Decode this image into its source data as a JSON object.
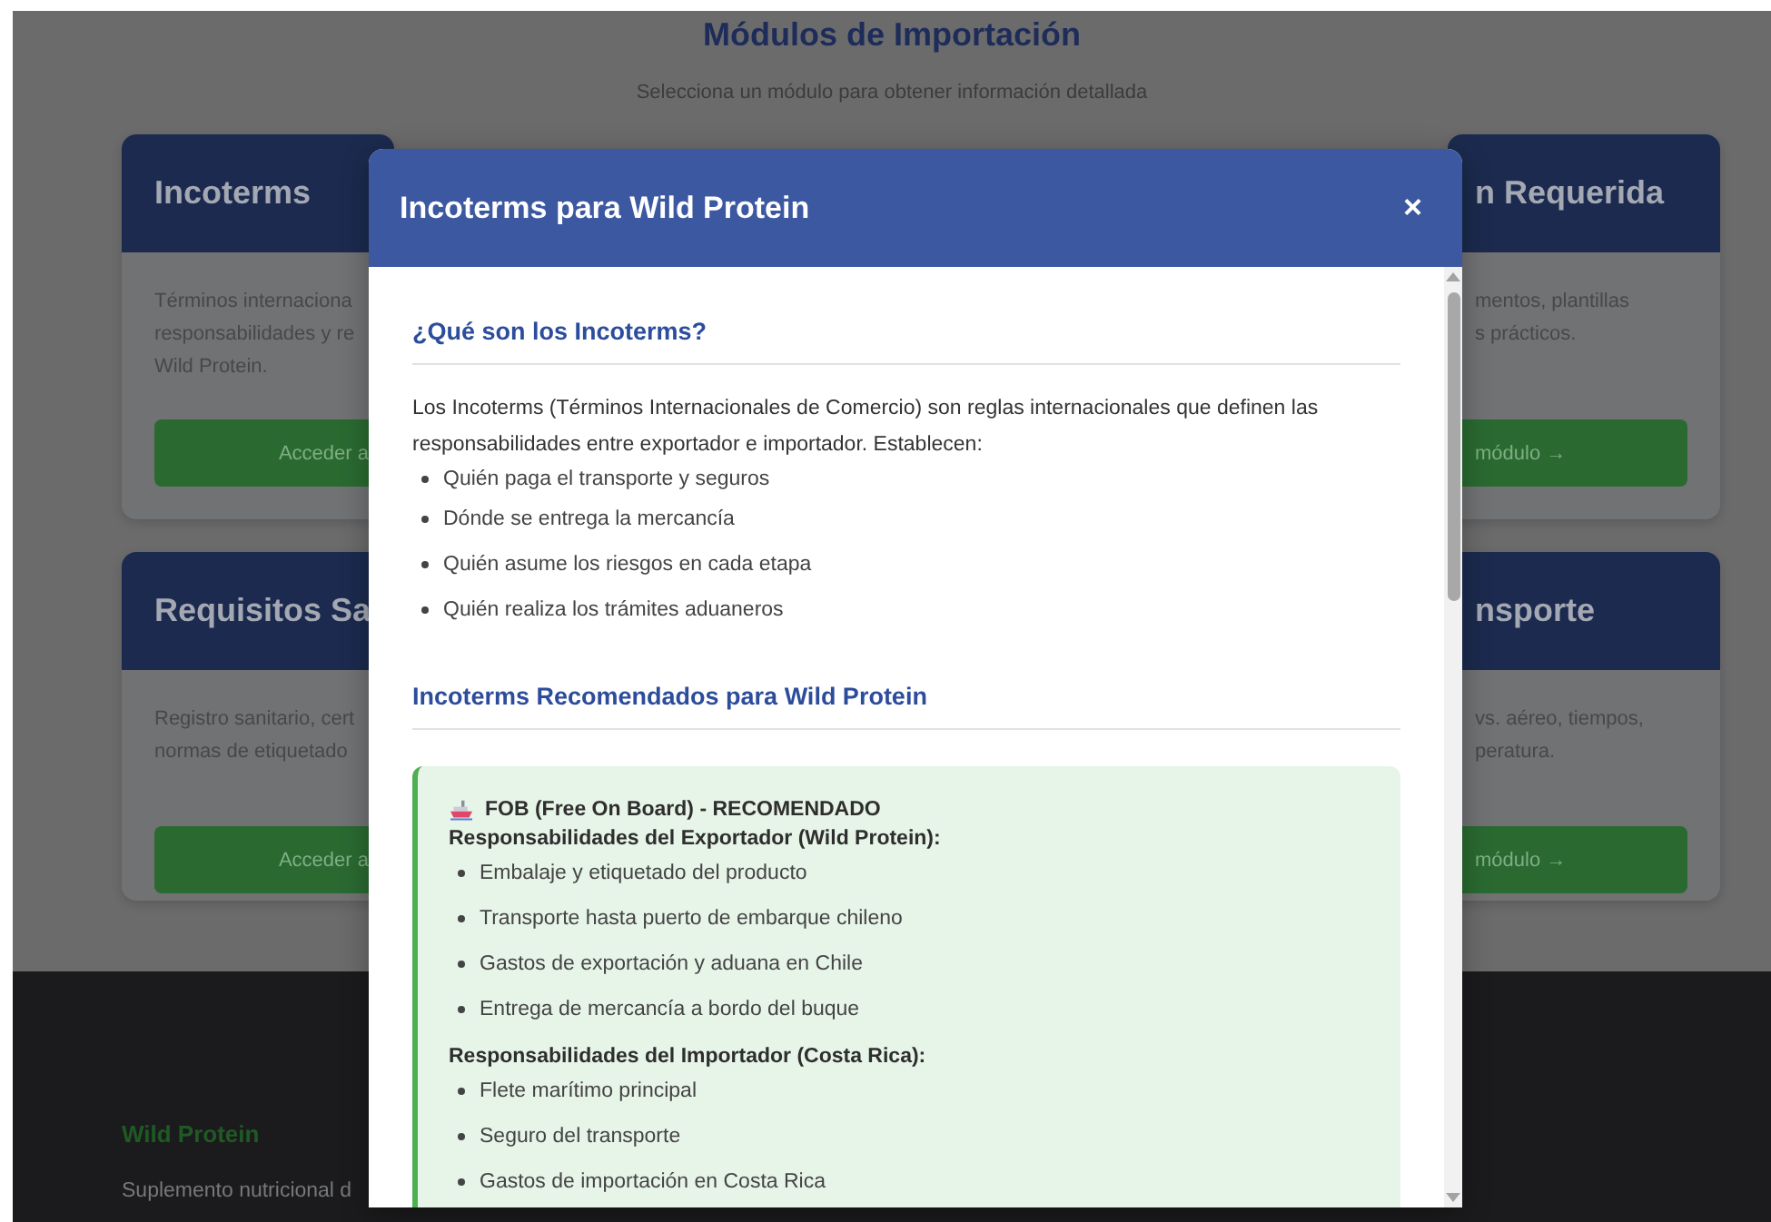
{
  "page": {
    "title": "Módulos de Importación",
    "subtitle": "Selecciona un módulo para obtener información detallada"
  },
  "cards": [
    {
      "kind": "left",
      "title": "Incoterms",
      "lines": [
        "Términos internaciona",
        "responsabilidades y re",
        "Wild Protein."
      ],
      "button": "Acceder a"
    },
    {
      "kind": "right",
      "title": "n Requerida",
      "lines": [
        "mentos, plantillas",
        "s prácticos."
      ],
      "button": "módulo →"
    },
    {
      "kind": "left",
      "title": "Requisitos Sa",
      "lines": [
        "Registro sanitario, cert",
        "normas de etiquetado"
      ],
      "button": "Acceder a"
    },
    {
      "kind": "right",
      "title": "nsporte",
      "lines": [
        "vs. aéreo, tiempos,",
        "peratura."
      ],
      "button": "módulo →"
    }
  ],
  "modal": {
    "title": "Incoterms para Wild Protein",
    "close": "×",
    "blocks": [
      {
        "kind": "heading",
        "text": "¿Qué son los Incoterms?"
      },
      {
        "kind": "paragraph",
        "text": "Los Incoterms (Términos Internacionales de Comercio) son reglas internacionales que definen las responsabilidades entre exportador e importador. Establecen:"
      },
      {
        "kind": "list",
        "items": [
          "Quién paga el transporte y seguros",
          "Dónde se entrega la mercancía",
          "Quién asume los riesgos en cada etapa",
          "Quién realiza los trámites aduaneros"
        ]
      },
      {
        "kind": "heading",
        "text": "Incoterms Recomendados para Wild Protein"
      },
      {
        "kind": "callout",
        "title": "FOB (Free On Board) - RECOMENDADO",
        "groups": [
          {
            "label": "Responsabilidades del Exportador (Wild Protein):",
            "items": [
              "Embalaje y etiquetado del producto",
              "Transporte hasta puerto de embarque chileno",
              "Gastos de exportación y aduana en Chile",
              "Entrega de mercancía a bordo del buque"
            ]
          },
          {
            "label": "Responsabilidades del Importador (Costa Rica):",
            "items": [
              "Flete marítimo principal",
              "Seguro del transporte",
              "Gastos de importación en Costa Rica"
            ]
          }
        ]
      }
    ]
  },
  "footer": {
    "brand": "Wild Protein",
    "text": "Suplemento nutricional d"
  }
}
